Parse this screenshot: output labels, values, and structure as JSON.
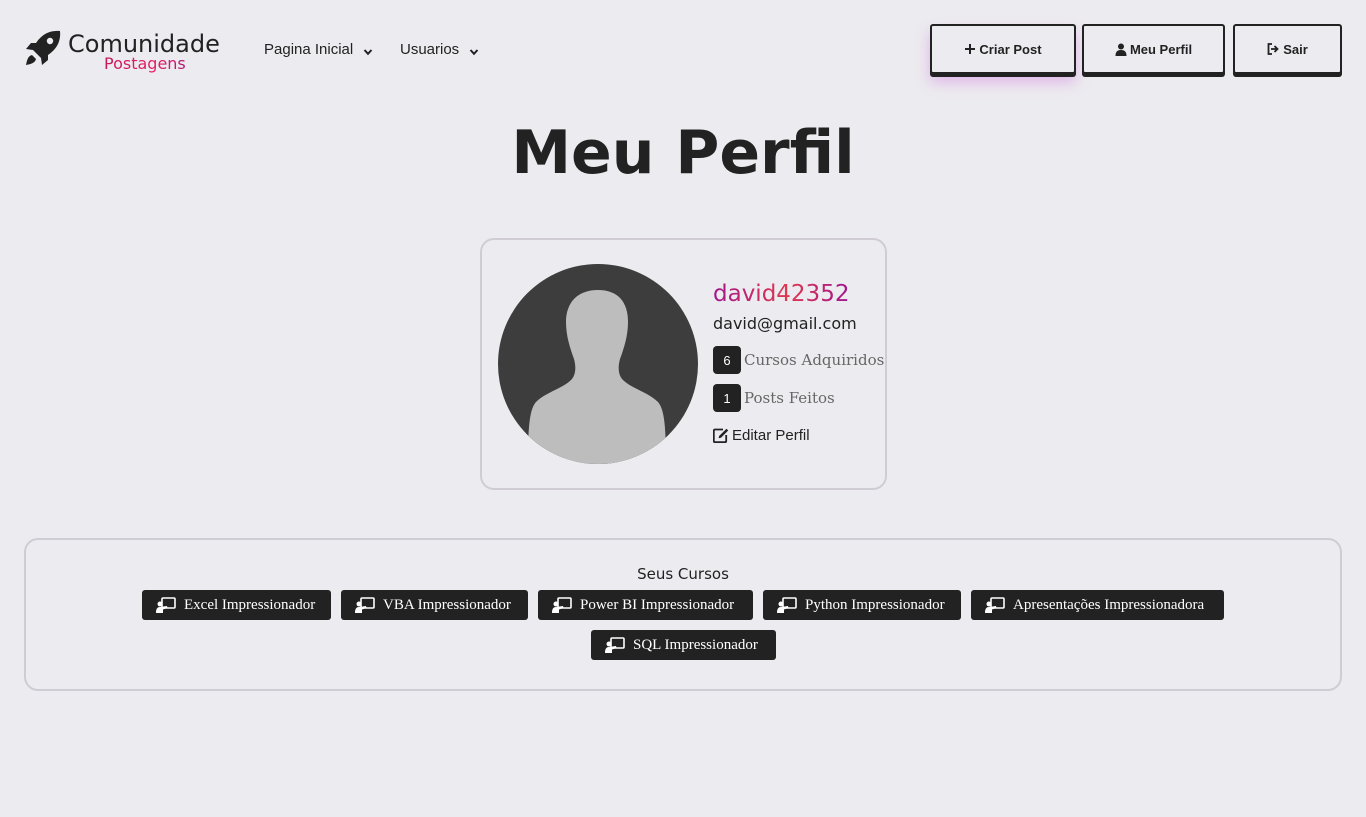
{
  "header": {
    "brand_name": "Comunidade",
    "brand_sub": "Postagens",
    "nav": [
      {
        "label": "Pagina Inicial"
      },
      {
        "label": "Usuarios"
      }
    ],
    "buttons": {
      "criar_post": "Criar Post",
      "meu_perfil": "Meu Perfil",
      "sair": "Sair"
    }
  },
  "page_title": "Meu Perfil",
  "profile": {
    "username": "david42352",
    "email": "david@gmail.com",
    "stats": [
      {
        "count": "6",
        "label": "Cursos Adquiridos"
      },
      {
        "count": "1",
        "label": "Posts Feitos"
      }
    ],
    "edit_label": "Editar Perfil"
  },
  "courses": {
    "title": "Seus Cursos",
    "items": [
      "Excel Impressionador",
      "VBA Impressionador",
      "Power BI Impressionador",
      "Python Impressionador",
      "Apresentações Impressionadora",
      "SQL Impressionador"
    ]
  },
  "icons": {
    "brand": "rocket-icon",
    "nav_dropdown": "chevron-down-icon",
    "criar_post": "plus-icon",
    "meu_perfil": "user-icon",
    "sair": "sign-out-icon",
    "edit": "edit-icon",
    "course": "chalkboard-teacher-icon"
  },
  "colors": {
    "background": "#ecebef",
    "text": "#222222",
    "badge": "#222222",
    "username_gradient": [
      "#a3168c",
      "#e0384e"
    ],
    "brand_sub_gradient": [
      "#c2185b",
      "#e91e63"
    ]
  }
}
